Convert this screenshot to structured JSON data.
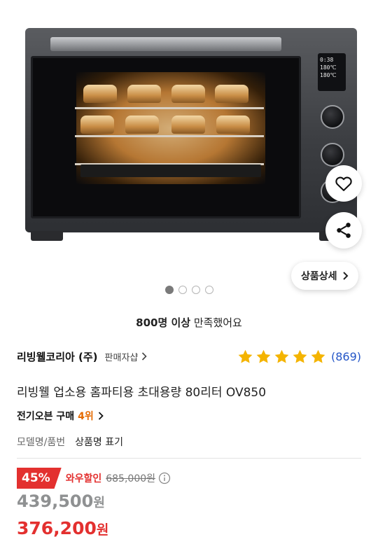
{
  "product_image": {
    "display_lines": [
      "0:38",
      "180℃",
      "180℃"
    ],
    "wishlist_icon": "heart-icon",
    "share_icon": "share-icon",
    "detail_button": "상품상세",
    "carousel": {
      "count": 4,
      "active": 1
    }
  },
  "satisfaction": {
    "bold": "800명 이상",
    "rest": " 만족했어요"
  },
  "seller": {
    "name": "리빙웰코리아 (주)",
    "link_label": "판매자샵",
    "stars": 5,
    "rating_count": "(869)"
  },
  "product": {
    "title": "리빙웰 업소용 홈파티용 초대용량 80리터 OV850",
    "rank_category": "전기오븐 구매",
    "rank_value": "4위",
    "model_label": "모델명/품번",
    "model_value": "상품명 표기"
  },
  "price": {
    "discount_percent": "45%",
    "wow_label": "와우할인",
    "original_price": "685,000원",
    "wow_price": "439,500",
    "wow_unit": "원",
    "final_price": "376,200",
    "final_unit": "원"
  },
  "colors": {
    "accent_red": "#e3302f",
    "star_gold": "#f4b400",
    "rating_blue": "#2456c7",
    "rank_orange": "#e56a00"
  }
}
